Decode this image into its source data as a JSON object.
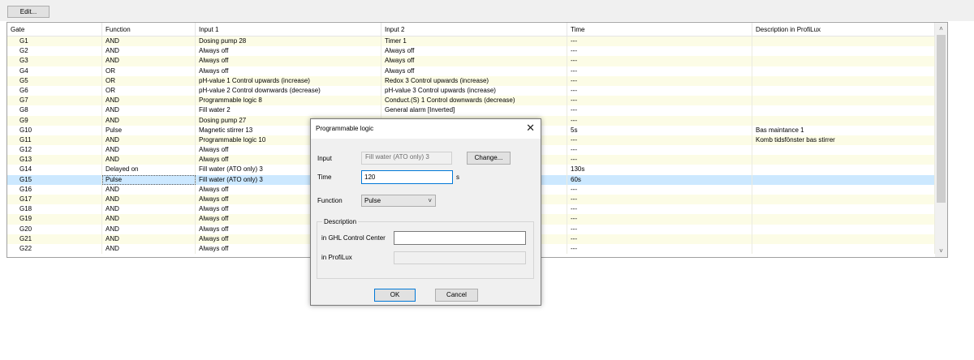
{
  "toolbar": {
    "edit_label": "Edit..."
  },
  "grid": {
    "columns": [
      "Gate",
      "Function",
      "Input 1",
      "Input 2",
      "Time",
      "Description in ProfiLux"
    ],
    "rows": [
      {
        "gate": "G1",
        "function": "AND",
        "input1": "Dosing pump 28",
        "input2": "Timer 1",
        "time": "---",
        "desc": ""
      },
      {
        "gate": "G2",
        "function": "AND",
        "input1": "Always off",
        "input2": "Always off",
        "time": "---",
        "desc": ""
      },
      {
        "gate": "G3",
        "function": "AND",
        "input1": "Always off",
        "input2": "Always off",
        "time": "---",
        "desc": ""
      },
      {
        "gate": "G4",
        "function": "OR",
        "input1": "Always off",
        "input2": "Always off",
        "time": "---",
        "desc": ""
      },
      {
        "gate": "G5",
        "function": "OR",
        "input1": "pH-value 1 Control upwards (increase)",
        "input2": "Redox 3 Control upwards (increase)",
        "time": "---",
        "desc": ""
      },
      {
        "gate": "G6",
        "function": "OR",
        "input1": "pH-value 2 Control downwards (decrease)",
        "input2": "pH-value 3 Control upwards (increase)",
        "time": "---",
        "desc": ""
      },
      {
        "gate": "G7",
        "function": "AND",
        "input1": "Programmable logic 8",
        "input2": "Conduct.(S) 1 Control downwards (decrease)",
        "time": "---",
        "desc": ""
      },
      {
        "gate": "G8",
        "function": "AND",
        "input1": "Fill water 2",
        "input2": "General alarm [Inverted]",
        "time": "---",
        "desc": ""
      },
      {
        "gate": "G9",
        "function": "AND",
        "input1": "Dosing pump 27",
        "input2": "",
        "time": "---",
        "desc": ""
      },
      {
        "gate": "G10",
        "function": "Pulse",
        "input1": "Magnetic stirrer 13",
        "input2": "",
        "time": "5s",
        "desc": "Bas maintance 1"
      },
      {
        "gate": "G11",
        "function": "AND",
        "input1": "Programmable logic 10",
        "input2": "",
        "time": "---",
        "desc": "Komb tidsfönster bas stirrer"
      },
      {
        "gate": "G12",
        "function": "AND",
        "input1": "Always off",
        "input2": "",
        "time": "---",
        "desc": ""
      },
      {
        "gate": "G13",
        "function": "AND",
        "input1": "Always off",
        "input2": "",
        "time": "---",
        "desc": ""
      },
      {
        "gate": "G14",
        "function": "Delayed on",
        "input1": "Fill water (ATO only) 3",
        "input2": "",
        "time": "130s",
        "desc": ""
      },
      {
        "gate": "G15",
        "function": "Pulse",
        "input1": "Fill water (ATO only) 3",
        "input2": "",
        "time": "60s",
        "desc": ""
      },
      {
        "gate": "G16",
        "function": "AND",
        "input1": "Always off",
        "input2": "",
        "time": "---",
        "desc": ""
      },
      {
        "gate": "G17",
        "function": "AND",
        "input1": "Always off",
        "input2": "",
        "time": "---",
        "desc": ""
      },
      {
        "gate": "G18",
        "function": "AND",
        "input1": "Always off",
        "input2": "",
        "time": "---",
        "desc": ""
      },
      {
        "gate": "G19",
        "function": "AND",
        "input1": "Always off",
        "input2": "",
        "time": "---",
        "desc": ""
      },
      {
        "gate": "G20",
        "function": "AND",
        "input1": "Always off",
        "input2": "",
        "time": "---",
        "desc": ""
      },
      {
        "gate": "G21",
        "function": "AND",
        "input1": "Always off",
        "input2": "",
        "time": "---",
        "desc": ""
      },
      {
        "gate": "G22",
        "function": "AND",
        "input1": "Always off",
        "input2": "",
        "time": "---",
        "desc": ""
      }
    ],
    "selected_row": "G15"
  },
  "scrollbar": {
    "up_icon": "chevron-up-icon",
    "down_icon": "chevron-down-icon"
  },
  "dialog": {
    "title": "Programmable logic",
    "close_icon": "close-icon",
    "input_label": "Input",
    "input_value": "Fill water (ATO only) 3",
    "change_label": "Change...",
    "time_label": "Time",
    "time_value": "120",
    "time_unit": "s",
    "function_label": "Function",
    "function_value": "Pulse",
    "description_group": "Description",
    "ghl_label": "in GHL Control Center",
    "ghl_value": "",
    "profilux_label": "in ProfiLux",
    "profilux_value": "",
    "ok_label": "OK",
    "cancel_label": "Cancel"
  }
}
